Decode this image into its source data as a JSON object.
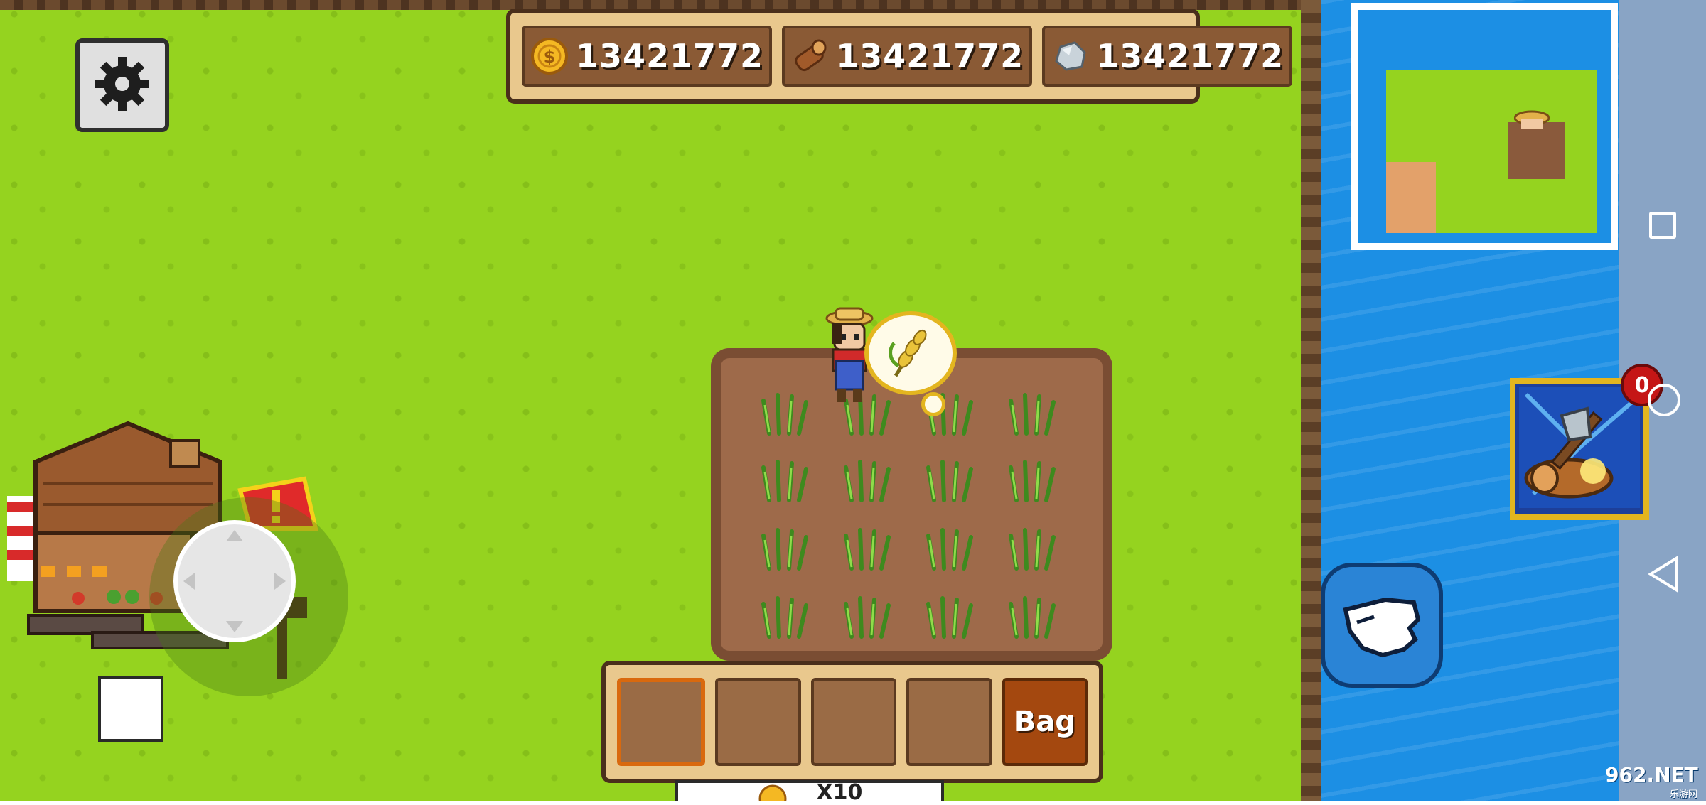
{
  "resources": [
    {
      "name": "coins",
      "icon": "coin-icon",
      "value": "13421772"
    },
    {
      "name": "wood",
      "icon": "wood-log-icon",
      "value": "13421772"
    },
    {
      "name": "stone",
      "icon": "stone-icon",
      "value": "13421772"
    }
  ],
  "hotbar": {
    "bag_label": "Bag",
    "selected_slot": 1
  },
  "reward_bar": {
    "icon": "coin-icon",
    "label": "X10"
  },
  "axe_button": {
    "badge": "0"
  },
  "watermark": {
    "main": "962.NET",
    "sub": "乐游网"
  },
  "colors": {
    "grass": "#95d31f",
    "water": "#1c8fe4",
    "panel": "#e9c88d",
    "soil": "#9e6a4a",
    "accent_gold": "#e3b51f"
  }
}
